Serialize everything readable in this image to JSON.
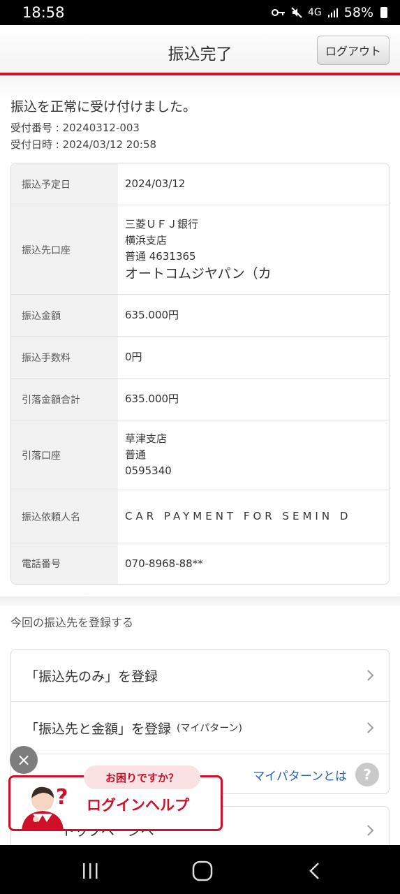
{
  "status_bar": {
    "time": "18:58",
    "network": "4G",
    "battery": "58%"
  },
  "header": {
    "title": "振込完了",
    "logout_label": "ログアウト"
  },
  "confirmation": {
    "message": "振込を正常に受け付けました。",
    "receipt_number": "受付番号 : 20240312-003",
    "receipt_datetime": "受付日時 : 2024/03/12 20:58"
  },
  "details": {
    "transfer_date": {
      "label": "振込予定日",
      "value": "2024/03/12"
    },
    "destination": {
      "label": "振込先口座",
      "bank": "三菱ＵＦＪ銀行",
      "branch": "横浜支店",
      "account": "普通 4631365",
      "name": "オートコムジヤパン（カ"
    },
    "amount": {
      "label": "振込金額",
      "value": "635.000円"
    },
    "fee": {
      "label": "振込手数料",
      "value": "0円"
    },
    "total": {
      "label": "引落金額合計",
      "value": "635.000円"
    },
    "debit_account": {
      "label": "引落口座",
      "branch": "草津支店",
      "type": "普通",
      "number": "0595340"
    },
    "requester": {
      "label": "振込依頼人名",
      "value": "CAR PAYMENT FOR SEMIN D"
    },
    "phone": {
      "label": "電話番号",
      "value": "070-8968-88**"
    }
  },
  "register": {
    "heading": "今回の振込先を登録する",
    "option1": "「振込先のみ」を登録",
    "option2": "「振込先と金額」を登録",
    "option2_sub": "(マイパターン)",
    "mypattern_link": "マイパターンとは",
    "help_icon": "?"
  },
  "top_page": {
    "label": "トップページへ"
  },
  "help_banner": {
    "pill": "お困りですか？",
    "text": "ログインヘルプ",
    "close": "×",
    "mark": "?"
  },
  "icons": [
    "key-icon",
    "mute-icon",
    "signal-icon",
    "battery-icon",
    "close-icon",
    "chevron-right-icon",
    "recent-apps-icon",
    "home-icon",
    "back-icon"
  ],
  "colors": {
    "accent_red": "#d0102b",
    "link_blue": "#2a62b5"
  }
}
